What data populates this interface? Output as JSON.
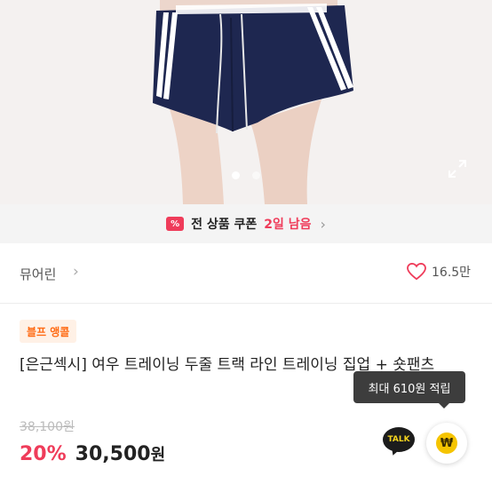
{
  "coupon": {
    "badge_icon": "coupon-percent-icon",
    "label": "전 상품 쿠폰",
    "remaining": "2일 남음",
    "chevron": "›"
  },
  "store": {
    "name": "뮤어린",
    "chevron": "›",
    "likes": "16.5만"
  },
  "product": {
    "tag": "블프 앵콜",
    "title": "[은근섹시] 여우 트레이닝 두줄 트랙 라인 트레이닝 집업 + 숏팬츠",
    "original_price": "38,100원",
    "discount": "20%",
    "price": "30,500",
    "currency": "원"
  },
  "reward_tooltip": "최대 610원 적립",
  "actions": {
    "talk_label": "TALK",
    "reward_symbol": "₩"
  },
  "carousel": {
    "active_index": 0,
    "total": 2
  },
  "colors": {
    "accent": "#ef3c5a",
    "tag_text": "#ff6a13",
    "shorts": "#1e2750"
  }
}
